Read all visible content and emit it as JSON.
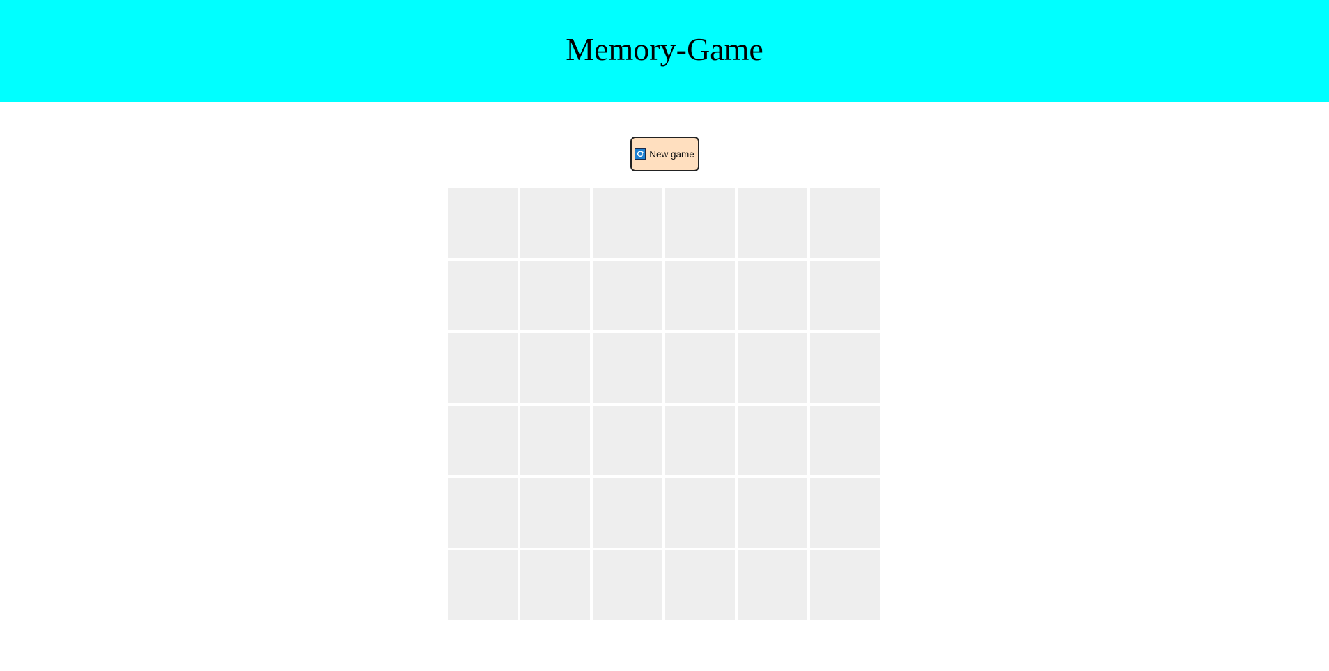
{
  "header": {
    "title": "Memory-Game"
  },
  "controls": {
    "new_game_label": "New game",
    "new_game_icon": "refresh-icon"
  },
  "board": {
    "rows": 6,
    "columns": 6,
    "face_down_cards": 36
  },
  "colors": {
    "header_background": "#00ffff",
    "button_background": "#ffdfbf",
    "card_back": "#eeeeee",
    "icon_background": "#1e7fd0"
  }
}
